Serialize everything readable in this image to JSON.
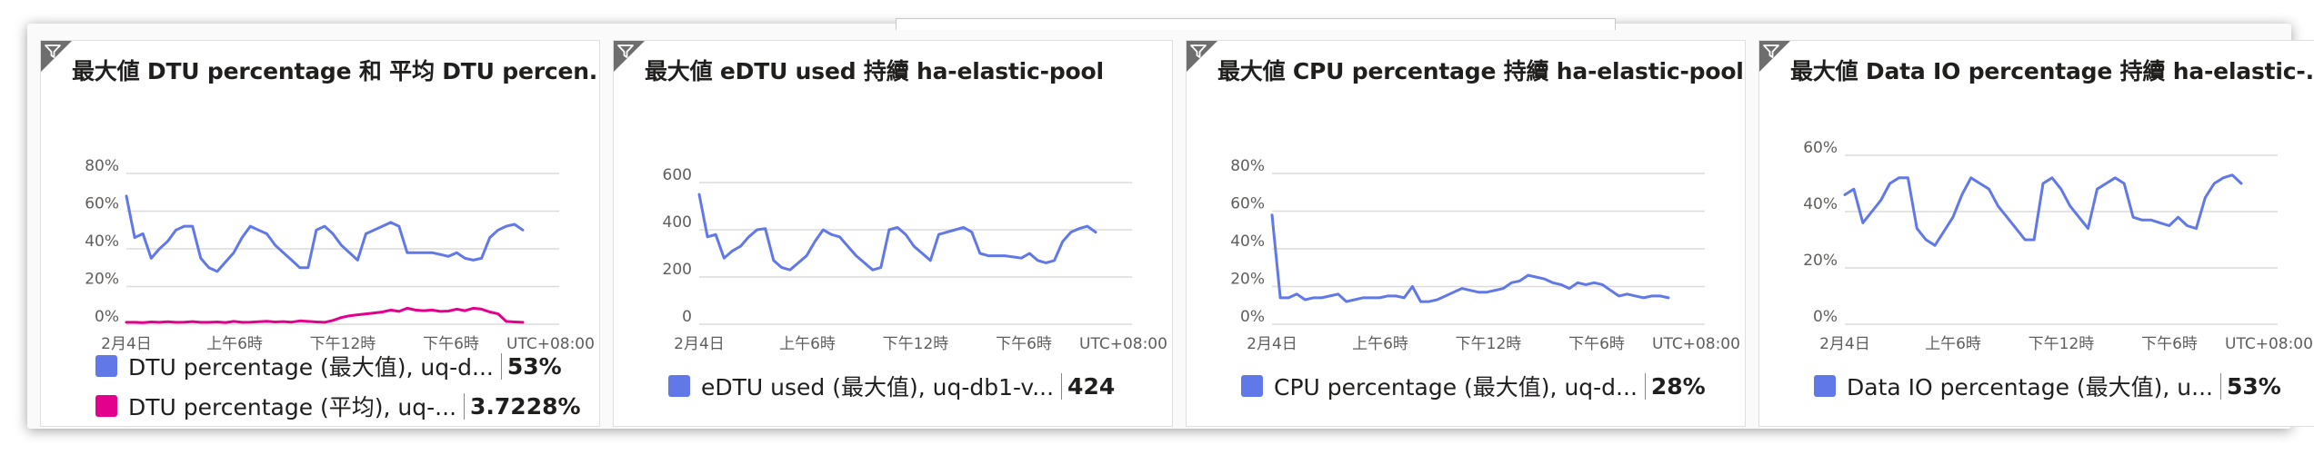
{
  "colors": {
    "series_blue": "#6178e8",
    "series_pink": "#e3008c",
    "grid": "#dcdcdc",
    "filter_badge": "#6e6e6e"
  },
  "tiles": [
    {
      "title": "最大値 DTU percentage 和 平均 DTU percen...",
      "legend": [
        {
          "label": "DTU percentage (最大值), uq-d...",
          "value": "53%",
          "color": "#6178e8"
        },
        {
          "label": "DTU percentage (平均), uq-...",
          "value": "3.7228%",
          "color": "#e3008c"
        }
      ]
    },
    {
      "title": "最大値 eDTU used 持續 ha-elastic-pool",
      "legend": [
        {
          "label": "eDTU used (最大值), uq-db1-v...",
          "value": "424",
          "color": "#6178e8"
        }
      ]
    },
    {
      "title": "最大値 CPU percentage 持續 ha-elastic-pool",
      "legend": [
        {
          "label": "CPU percentage (最大值), uq-d...",
          "value": "28%",
          "color": "#6178e8"
        }
      ]
    },
    {
      "title": "最大値 Data IO percentage 持續 ha-elastic-...",
      "legend": [
        {
          "label": "Data IO percentage (最大值), u...",
          "value": "53%",
          "color": "#6178e8"
        }
      ]
    }
  ],
  "chart_data": [
    {
      "type": "line",
      "title": "最大値 DTU percentage 和 平均 DTU percen...",
      "x_tick_labels": [
        "2月4日",
        "上午6時",
        "下午12時",
        "下午6時",
        "UTC+08:00"
      ],
      "y_tick_labels": [
        "0%",
        "20%",
        "40%",
        "60%",
        "80%"
      ],
      "ylim": [
        0,
        80
      ],
      "grid": true,
      "legend_position": "bottom",
      "series": [
        {
          "name": "DTU percentage (最大值), uq-d...",
          "color": "#6178e8",
          "values": [
            68,
            46,
            48,
            35,
            40,
            44,
            50,
            52,
            52,
            35,
            30,
            28,
            33,
            38,
            46,
            52,
            50,
            48,
            42,
            38,
            34,
            30,
            30,
            50,
            52,
            48,
            42,
            38,
            34,
            48,
            50,
            52,
            54,
            52,
            38,
            38,
            38,
            38,
            37,
            36,
            38,
            35,
            34,
            35,
            46,
            50,
            52,
            53,
            50
          ]
        },
        {
          "name": "DTU percentage (平均), uq-...",
          "color": "#e3008c",
          "values": [
            1,
            1,
            0.8,
            1.2,
            1,
            1.3,
            1,
            1.1,
            1.4,
            1,
            1,
            1.2,
            0.9,
            1.5,
            1,
            1.1,
            1.3,
            1.6,
            1.2,
            1.4,
            1.1,
            1.8,
            1.5,
            1.2,
            1,
            2,
            3.5,
            4.5,
            5,
            5.5,
            6,
            6.5,
            7.5,
            6.8,
            8.5,
            7.5,
            7.2,
            7.5,
            6.8,
            7,
            8,
            7.2,
            8.5,
            8,
            6.5,
            5.5,
            1.5,
            1.2,
            1
          ]
        }
      ]
    },
    {
      "type": "line",
      "title": "最大値 eDTU used 持續 ha-elastic-pool",
      "x_tick_labels": [
        "2月4日",
        "上午6時",
        "下午12時",
        "下午6時",
        "UTC+08:00"
      ],
      "y_tick_labels": [
        "0",
        "200",
        "400",
        "600"
      ],
      "ylim": [
        0,
        600
      ],
      "grid": true,
      "legend_position": "bottom",
      "series": [
        {
          "name": "eDTU used (最大值), uq-db1-v...",
          "color": "#6178e8",
          "values": [
            550,
            370,
            380,
            280,
            310,
            330,
            370,
            400,
            405,
            270,
            240,
            230,
            260,
            290,
            350,
            400,
            380,
            370,
            330,
            290,
            260,
            230,
            240,
            400,
            410,
            380,
            330,
            300,
            270,
            380,
            390,
            400,
            410,
            390,
            300,
            290,
            290,
            290,
            285,
            280,
            300,
            270,
            260,
            270,
            350,
            390,
            405,
            415,
            390
          ]
        }
      ]
    },
    {
      "type": "line",
      "title": "最大値 CPU percentage 持續 ha-elastic-pool",
      "x_tick_labels": [
        "2月4日",
        "上午6時",
        "下午12時",
        "下午6時",
        "UTC+08:00"
      ],
      "y_tick_labels": [
        "0%",
        "20%",
        "40%",
        "60%",
        "80%"
      ],
      "ylim": [
        0,
        80
      ],
      "grid": true,
      "legend_position": "bottom",
      "series": [
        {
          "name": "CPU percentage (最大值), uq-d...",
          "color": "#6178e8",
          "values": [
            58,
            14,
            14,
            16,
            13,
            14,
            14,
            15,
            16,
            12,
            13,
            14,
            14,
            14,
            15,
            15,
            14,
            20,
            12,
            12,
            13,
            15,
            17,
            19,
            18,
            17,
            17,
            18,
            19,
            22,
            23,
            26,
            25,
            24,
            22,
            21,
            19,
            22,
            21,
            22,
            21,
            18,
            15,
            16,
            15,
            14,
            15,
            15,
            14
          ]
        }
      ]
    },
    {
      "type": "line",
      "title": "最大値 Data IO percentage 持續 ha-elastic-...",
      "x_tick_labels": [
        "2月4日",
        "上午6時",
        "下午12時",
        "下午6時",
        "UTC+08:00"
      ],
      "y_tick_labels": [
        "0%",
        "20%",
        "40%",
        "60%"
      ],
      "ylim": [
        0,
        60
      ],
      "grid": true,
      "legend_position": "bottom",
      "series": [
        {
          "name": "Data IO percentage (最大值), u...",
          "color": "#6178e8",
          "values": [
            46,
            48,
            36,
            40,
            44,
            50,
            52,
            52,
            34,
            30,
            28,
            33,
            38,
            46,
            52,
            50,
            48,
            42,
            38,
            34,
            30,
            30,
            50,
            52,
            48,
            42,
            38,
            34,
            48,
            50,
            52,
            50,
            38,
            37,
            37,
            36,
            35,
            38,
            35,
            34,
            45,
            50,
            52,
            53,
            50
          ]
        }
      ]
    }
  ]
}
